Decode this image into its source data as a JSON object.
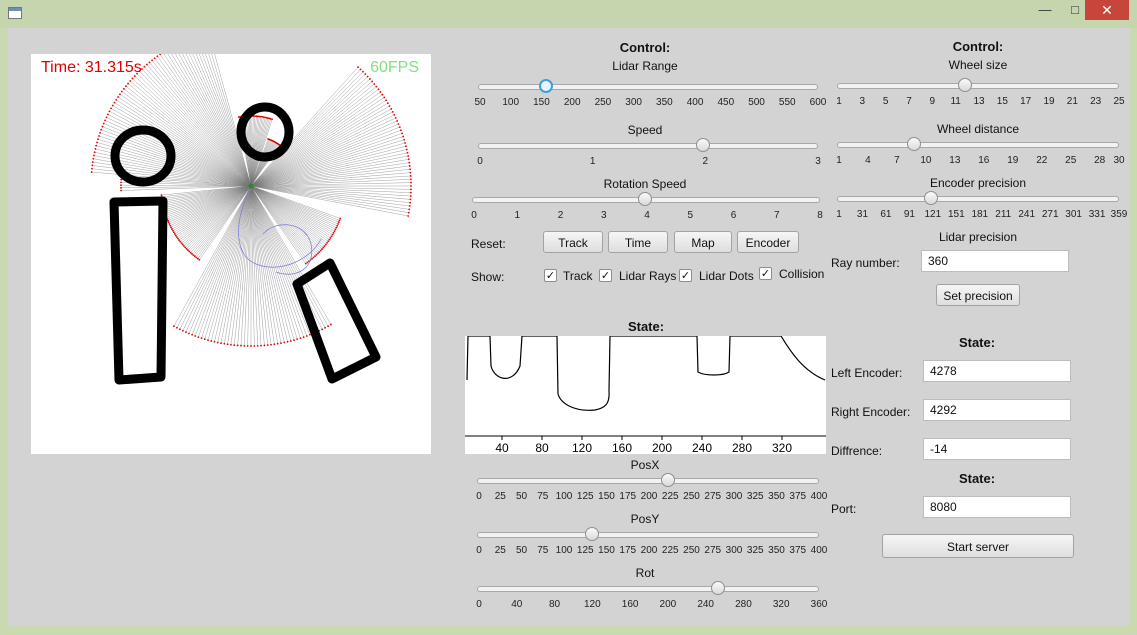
{
  "sim": {
    "time_text": "Time: 31.315s",
    "fps_text": "60FPS"
  },
  "control_left": {
    "header": "Control:",
    "lidar_range": {
      "label": "Lidar Range",
      "value": 160,
      "min": 50,
      "max": 600,
      "ticks": [
        "50",
        "100",
        "150",
        "200",
        "250",
        "300",
        "350",
        "400",
        "450",
        "500",
        "550",
        "600"
      ]
    },
    "speed": {
      "label": "Speed",
      "value": 2,
      "min": 0,
      "max": 3,
      "ticks": [
        "0",
        "1",
        "2",
        "3"
      ]
    },
    "rotation_speed": {
      "label": "Rotation Speed",
      "value": 4,
      "min": 0,
      "max": 8,
      "ticks": [
        "0",
        "1",
        "2",
        "3",
        "4",
        "5",
        "6",
        "7",
        "8"
      ]
    }
  },
  "reset": {
    "label": "Reset:",
    "buttons": [
      "Track",
      "Time",
      "Map",
      "Encoder"
    ]
  },
  "show": {
    "label": "Show:",
    "items": [
      {
        "label": "Track",
        "checked": true
      },
      {
        "label": "Lidar Rays",
        "checked": true
      },
      {
        "label": "Lidar Dots",
        "checked": true
      },
      {
        "label": "Collision",
        "checked": true
      }
    ]
  },
  "control_right": {
    "header": "Control:",
    "wheel_size": {
      "label": "Wheel size",
      "value": 12,
      "min": 1,
      "max": 25,
      "ticks": [
        "1",
        "3",
        "5",
        "7",
        "9",
        "11",
        "13",
        "15",
        "17",
        "19",
        "21",
        "23",
        "25"
      ]
    },
    "wheel_distance": {
      "label": "Wheel distance",
      "value": 9,
      "min": 1,
      "max": 30,
      "ticks": [
        "1",
        "4",
        "7",
        "10",
        "13",
        "16",
        "19",
        "22",
        "25",
        "28",
        "30"
      ]
    },
    "encoder_precision": {
      "label": "Encoder precision",
      "value": 121,
      "min": 1,
      "max": 359,
      "ticks": [
        "1",
        "31",
        "61",
        "91",
        "121",
        "151",
        "181",
        "211",
        "241",
        "271",
        "301",
        "331",
        "359"
      ]
    }
  },
  "lidar_precision": {
    "title": "Lidar precision",
    "ray_label": "Ray number:",
    "ray_value": "360",
    "button": "Set precision"
  },
  "state_chart": {
    "header": "State:",
    "x_ticks": [
      "40",
      "80",
      "120",
      "160",
      "200",
      "240",
      "280",
      "320"
    ]
  },
  "pos": {
    "posx": {
      "label": "PosX",
      "value": 225,
      "min": 0,
      "max": 400,
      "ticks": [
        "0",
        "25",
        "50",
        "75",
        "100",
        "125",
        "150",
        "175",
        "200",
        "225",
        "250",
        "275",
        "300",
        "325",
        "350",
        "375",
        "400"
      ]
    },
    "posy": {
      "label": "PosY",
      "value": 135,
      "min": 0,
      "max": 400,
      "ticks": [
        "0",
        "25",
        "50",
        "75",
        "100",
        "125",
        "150",
        "175",
        "200",
        "225",
        "250",
        "275",
        "300",
        "325",
        "350",
        "375",
        "400"
      ]
    },
    "rot": {
      "label": "Rot",
      "value": 255,
      "min": 0,
      "max": 360,
      "ticks": [
        "0",
        "40",
        "80",
        "120",
        "160",
        "200",
        "240",
        "280",
        "320",
        "360"
      ]
    }
  },
  "encoders": {
    "header": "State:",
    "left_label": "Left Encoder:",
    "left_value": "4278",
    "right_label": "Right Encoder:",
    "right_value": "4292",
    "diff_label": "Diffrence:",
    "diff_value": "-14"
  },
  "server": {
    "header": "State:",
    "port_label": "Port:",
    "port_value": "8080",
    "button": "Start server"
  },
  "colors": {
    "time": "#e00000",
    "fps": "#80e080",
    "lidar_dots": "#e00000",
    "rays": "#555555"
  }
}
